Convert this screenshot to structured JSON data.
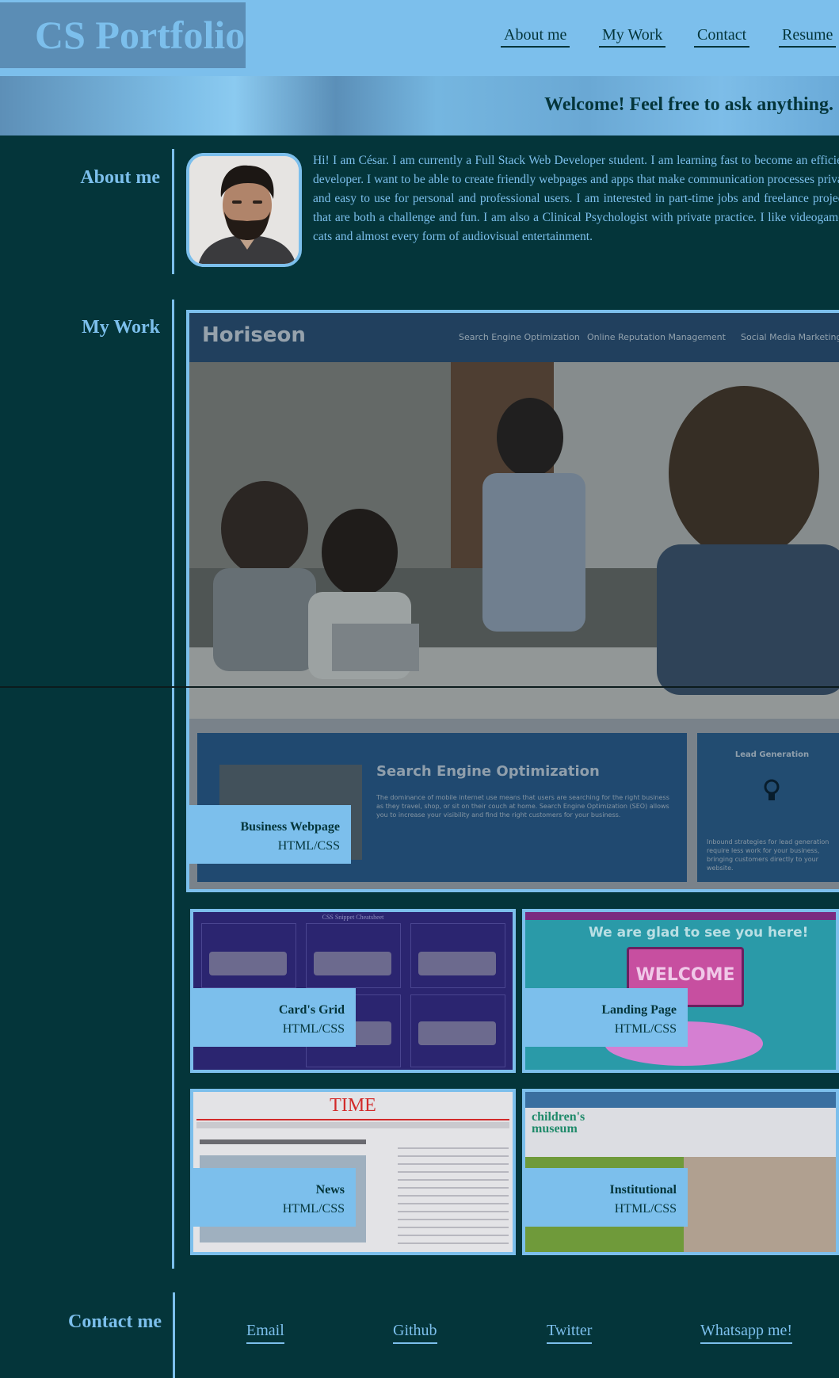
{
  "header": {
    "logo": "CS Portfolio",
    "nav": [
      "About me",
      "My Work",
      "Contact",
      "Resume"
    ]
  },
  "banner": {
    "text": "Welcome! Feel free to ask anything."
  },
  "about": {
    "label": "About me",
    "text": "Hi! I am César. I am currently a Full Stack Web Developer student. I am learning fast to become an efficient developer. I want to be able to create friendly webpages and apps that make communication processes private and easy to use for personal and professional users. I am interested in part-time jobs and freelance projects that are both a challenge and fun. I am also a Clinical Psychologist with private practice. I like videogames, cats and almost every form of audiovisual entertainment."
  },
  "work": {
    "label": "My Work",
    "featured": {
      "brand": "Horiseon",
      "nav": [
        "Search Engine Optimization",
        "Online Reputation Management",
        "Social Media Marketing"
      ],
      "section_title": "Search Engine Optimization",
      "section_text": "The dominance of mobile internet use means that users are searching for the right business as they travel, shop, or sit on their couch at home. Search Engine Optimization (SEO) allows you to increase your visibility and find the right customers for your business.",
      "side_title": "Lead Generation",
      "side_text": "Inbound strategies for lead generation require less work for your business, bringing customers directly to your website.",
      "title": "Business Webpage",
      "tech": "HTML/CSS"
    },
    "projects": [
      {
        "title": "Card's Grid",
        "tech": "HTML/CSS",
        "shot_title": "CSS Snippet Cheatsheet"
      },
      {
        "title": "Landing Page",
        "tech": "HTML/CSS",
        "shot_title": "We are glad to see you here!",
        "shot_sign": "WELCOME"
      },
      {
        "title": "News",
        "tech": "HTML/CSS",
        "shot_title": "TIME"
      },
      {
        "title": "Institutional",
        "tech": "HTML/CSS",
        "shot_title": "children's museum"
      }
    ]
  },
  "contact": {
    "label": "Contact me",
    "links": [
      "Email",
      "Github",
      "Twitter",
      "Whatsapp me!"
    ]
  }
}
